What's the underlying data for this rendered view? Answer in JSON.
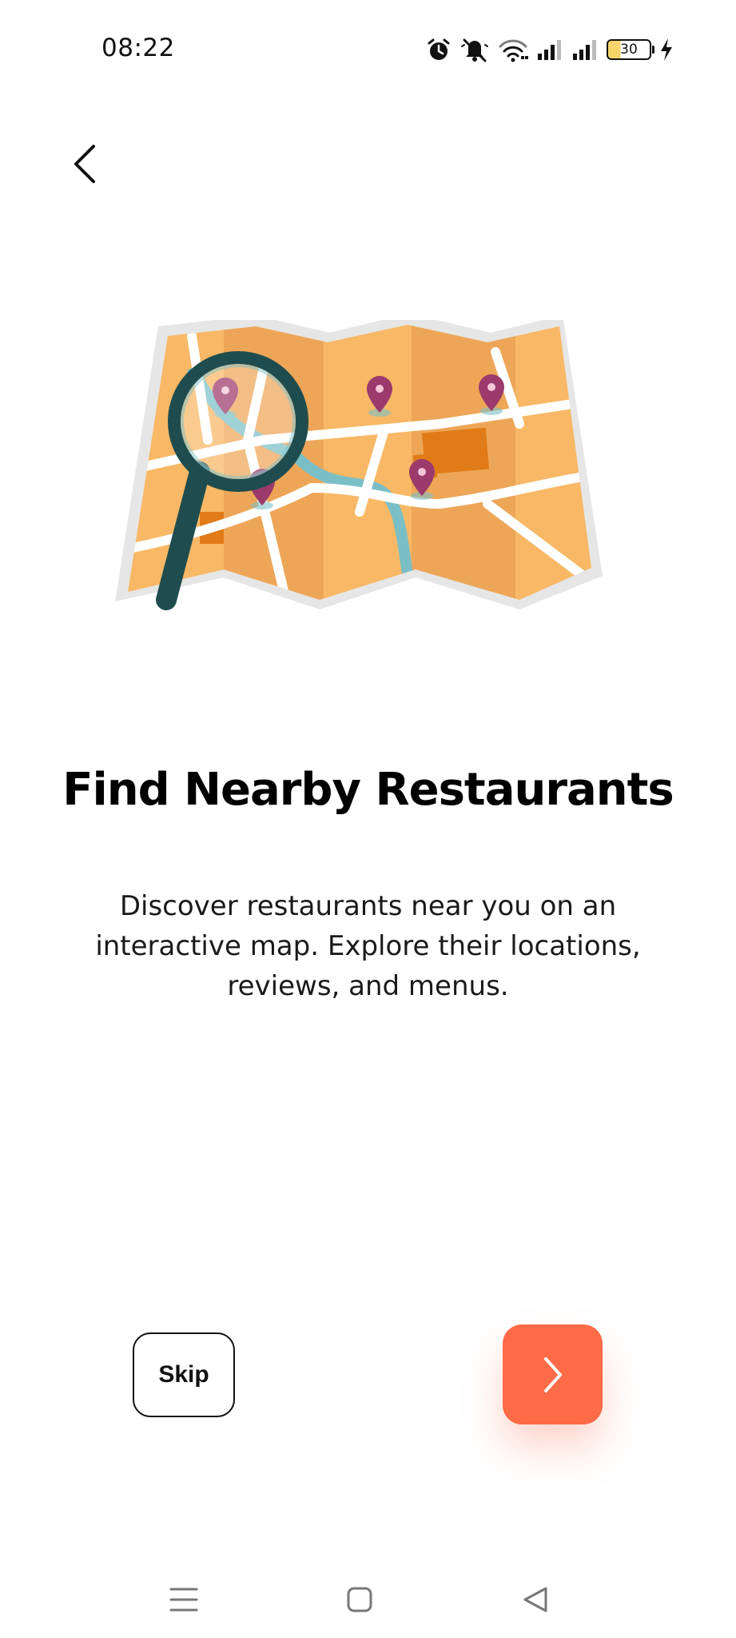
{
  "status_bar": {
    "time": "08:22",
    "battery_level": "30",
    "icons": [
      "alarm-icon",
      "mute-icon",
      "wifi-icon",
      "signal-icon",
      "signal-icon",
      "battery-icon",
      "charging-icon"
    ]
  },
  "header": {
    "back_icon": "chevron-left-icon"
  },
  "onboarding": {
    "illustration": "map-with-magnifier-illustration",
    "title": "Find Nearby Restaurants",
    "description": "Discover restaurants near you on an interactive map. Explore their locations, reviews, and menus."
  },
  "actions": {
    "skip_label": "Skip",
    "next_icon": "chevron-right-icon"
  },
  "nav_bar": {
    "items": [
      "menu-icon",
      "home-icon",
      "back-triangle-icon"
    ]
  },
  "colors": {
    "accent": "#ff6b47",
    "map_orange": "#f8b865",
    "map_dark_orange": "#e48a1f",
    "pin_purple": "#9b3a6b",
    "river_blue": "#7bbfc6",
    "magnifier_dark": "#1f4d4f"
  }
}
